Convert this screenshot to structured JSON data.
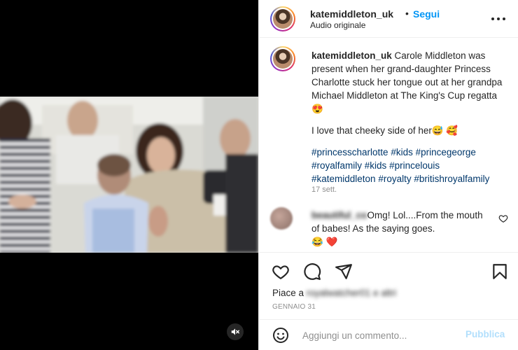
{
  "post": {
    "username": "katemiddleton_uk",
    "dot": "•",
    "follow_label": "Segui",
    "audio": "Audio originale"
  },
  "caption": {
    "username": "katemiddleton_uk",
    "text": "Carole Middleton was present when her grand-daughter Princess Charlotte stuck her tongue out at her grandpa Michael Middleton at The King's Cup regatta 😍",
    "line2": "I love that cheeky side of her😅 🥰",
    "hashtags": [
      "#princesscharlotte",
      "#kids",
      "#princegeorge",
      "#royalfamily",
      "#kids",
      "#princelouis",
      "#katemiddleton",
      "#royalty",
      "#britishroyalfamily"
    ],
    "time": "17 sett."
  },
  "comment": {
    "username_blurred": "beautiful_co",
    "text": "Omg! Lol....From the mouth of babes! As the saying goes.",
    "emojis": "😂 ❤️"
  },
  "actions": {
    "likes_prefix": "Piace a",
    "likes_user_blurred": "royalwatcher01 e altri",
    "date": "GENNAIO 31"
  },
  "comment_bar": {
    "placeholder": "Aggiungi un commento...",
    "publish_label": "Pubblica"
  },
  "icons": [
    "more-icon",
    "heart-icon",
    "comment-icon",
    "share-icon",
    "bookmark-icon",
    "emoji-icon",
    "mute-icon"
  ],
  "colors": {
    "link": "#0095f6",
    "hashtag": "#00376b",
    "publish_disabled": "#b2dffc",
    "heart_red": "#ed4956"
  }
}
